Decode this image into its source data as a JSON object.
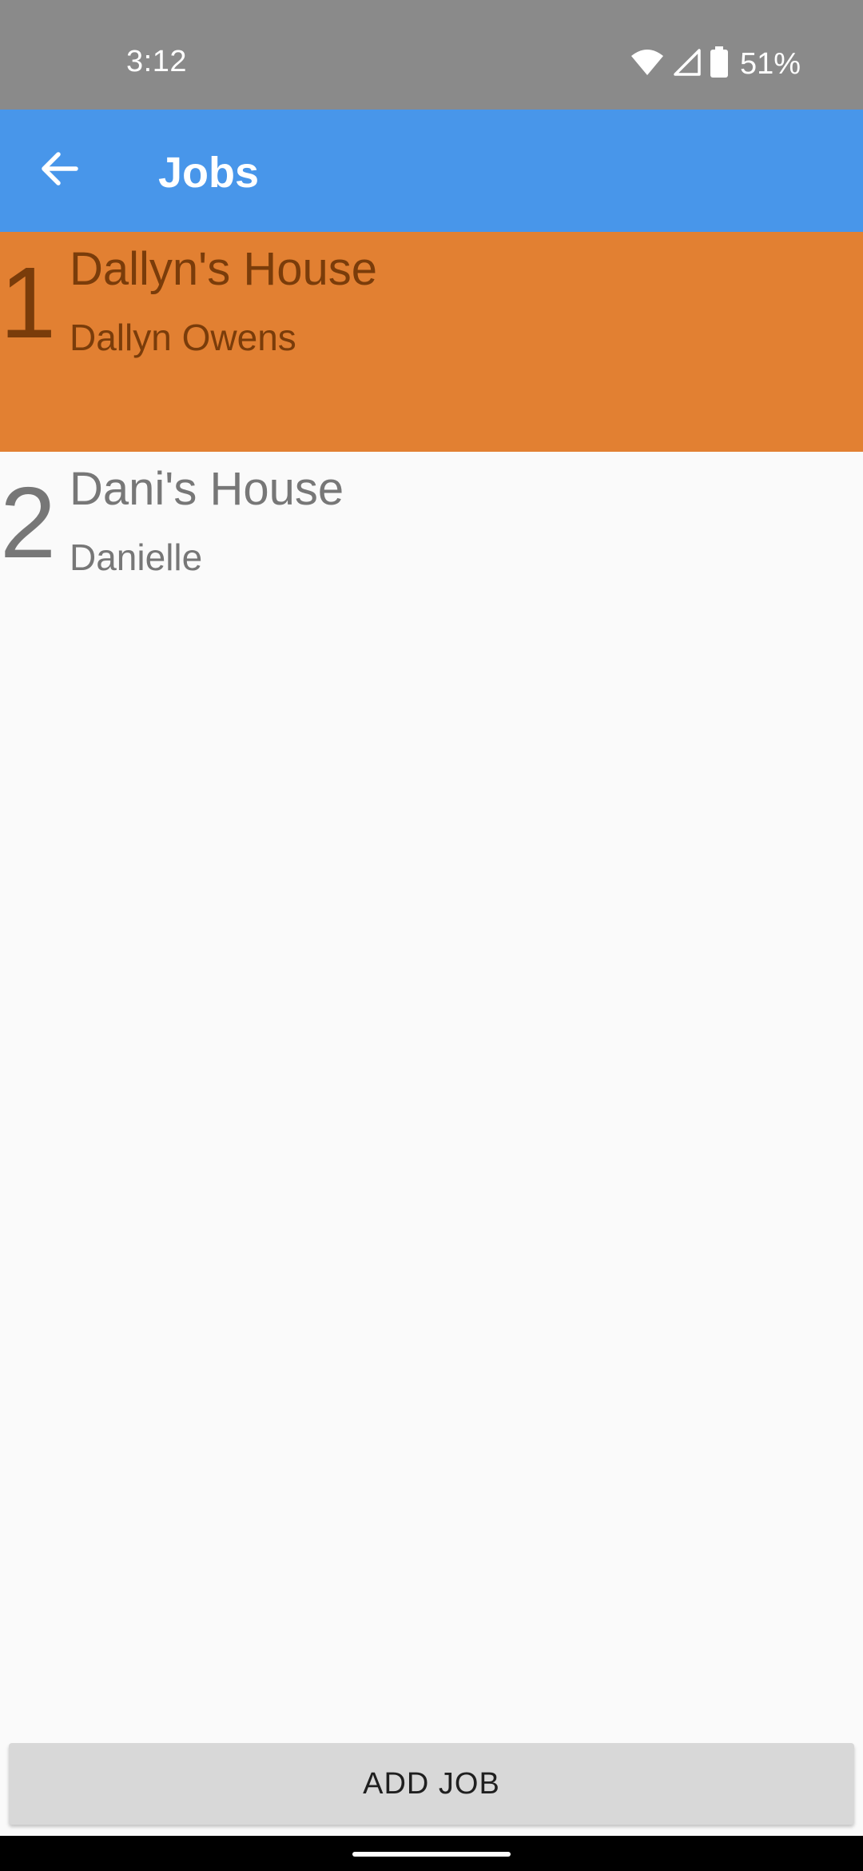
{
  "status_bar": {
    "time": "3:12",
    "battery_percent": "51%",
    "icons": [
      "wifi-icon",
      "cellular-signal-icon",
      "battery-icon"
    ]
  },
  "app_bar": {
    "title": "Jobs",
    "back_icon": "arrow-back-icon",
    "color": "#4896ea"
  },
  "jobs": [
    {
      "number": "1",
      "name": "Dallyn's House",
      "owner": "Dallyn Owens",
      "selected": true
    },
    {
      "number": "2",
      "name": "Dani's House",
      "owner": "Danielle",
      "selected": false
    }
  ],
  "colors": {
    "selected_row": "#e28032",
    "status_bar": "#8a8a8a"
  },
  "add_job_button": {
    "label": "ADD JOB"
  }
}
